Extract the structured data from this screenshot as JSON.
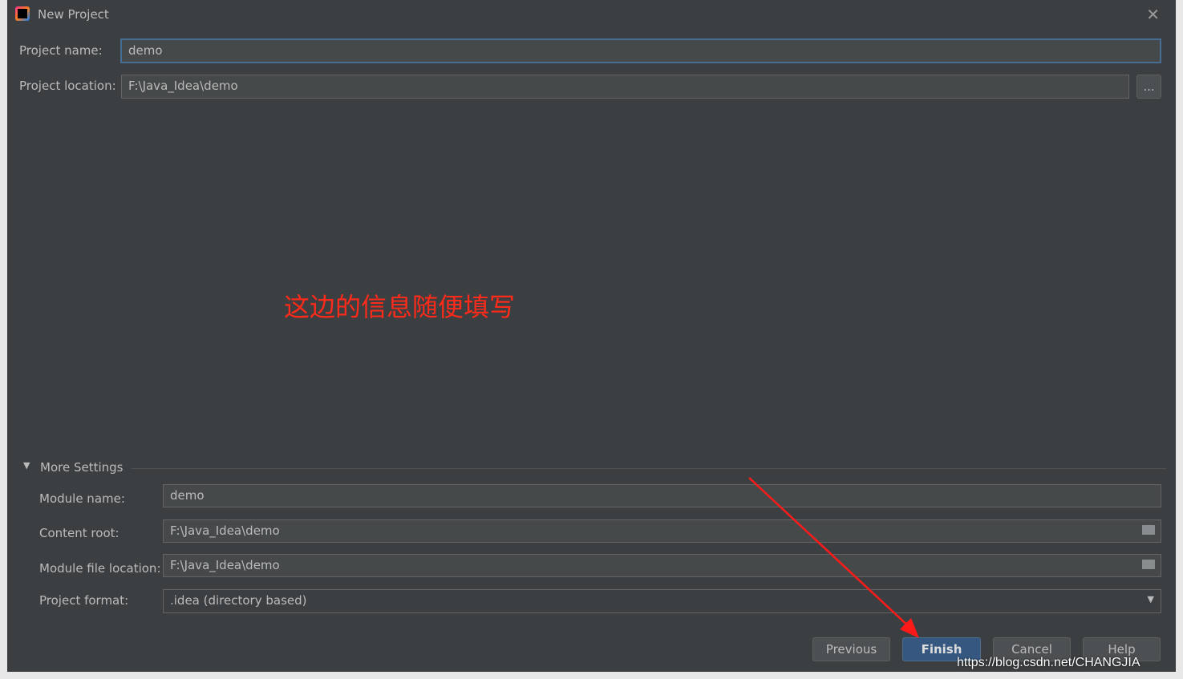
{
  "window": {
    "title": "New Project"
  },
  "form": {
    "project_name_label": "Project name:",
    "project_name": "demo",
    "project_location_label": "Project location:",
    "project_location": "F:\\Java_Idea\\demo",
    "browse_label": "..."
  },
  "annotation": "这边的信息随便填写",
  "more_settings": {
    "label": "More Settings",
    "module_name_label": "Module name:",
    "module_name": "demo",
    "content_root_label": "Content root:",
    "content_root": "F:\\Java_Idea\\demo",
    "module_file_label": "Module file location:",
    "module_file": "F:\\Java_Idea\\demo",
    "format_label": "Project format:",
    "format": ".idea (directory based)"
  },
  "buttons": {
    "previous": "Previous",
    "finish": "Finish",
    "cancel": "Cancel",
    "help": "Help"
  },
  "watermark": "https://blog.csdn.net/CHANGJIA",
  "colors": {
    "accent": "#365880",
    "annotation": "#ff2a1a"
  }
}
